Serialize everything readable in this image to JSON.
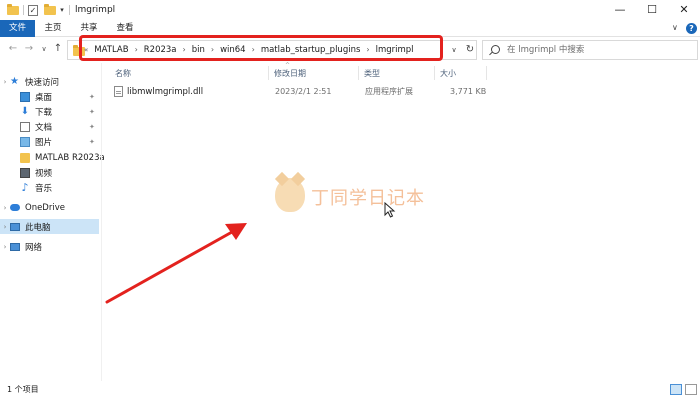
{
  "window": {
    "title": "lmgrimpl",
    "minimize": "—",
    "maximize": "☐",
    "close": "✕"
  },
  "ribbon": {
    "tabs": [
      "文件",
      "主页",
      "共享",
      "查看"
    ],
    "expand": "∨",
    "help": "?"
  },
  "nav": {
    "back": "←",
    "forward": "→",
    "recent": "∨",
    "up": "↑",
    "address_lead": "«",
    "breadcrumb": [
      "MATLAB",
      "R2023a",
      "bin",
      "win64",
      "matlab_startup_plugins",
      "lmgrimpl"
    ],
    "crumb_sep": "›",
    "address_dropdown": "∨",
    "refresh": "↻"
  },
  "search": {
    "placeholder": "在 lmgrimpl 中搜索"
  },
  "sidebar": {
    "items": [
      {
        "label": "快速访问",
        "icon": "star-icon"
      },
      {
        "label": "桌面",
        "icon": "desktop-icon",
        "pinned": true
      },
      {
        "label": "下载",
        "icon": "download-icon",
        "pinned": true
      },
      {
        "label": "文档",
        "icon": "document-icon",
        "pinned": true
      },
      {
        "label": "图片",
        "icon": "picture-icon",
        "pinned": true
      },
      {
        "label": "MATLAB R2023a",
        "icon": "folder-icon"
      },
      {
        "label": "视频",
        "icon": "video-icon"
      },
      {
        "label": "音乐",
        "icon": "music-icon"
      },
      {
        "label": "OneDrive",
        "icon": "cloud-icon"
      },
      {
        "label": "此电脑",
        "icon": "computer-icon",
        "selected": true
      },
      {
        "label": "网络",
        "icon": "network-icon"
      }
    ],
    "pin_glyph": "📌",
    "expand_glyph": "›"
  },
  "columns": {
    "name": "名称",
    "modified": "修改日期",
    "type": "类型",
    "size": "大小",
    "sort_indicator": "^"
  },
  "files": [
    {
      "name": "libmwlmgrimpl.dll",
      "modified": "2023/2/1 2:51",
      "type": "应用程序扩展",
      "size": "3,771 KB"
    }
  ],
  "watermark": {
    "text": "丁同学日记本"
  },
  "status": {
    "count": "1 个项目"
  },
  "colors": {
    "accent": "#1a67b9",
    "highlight_box": "#e3221e",
    "arrow": "#e3221e",
    "selected_bg": "#cce4f7"
  }
}
